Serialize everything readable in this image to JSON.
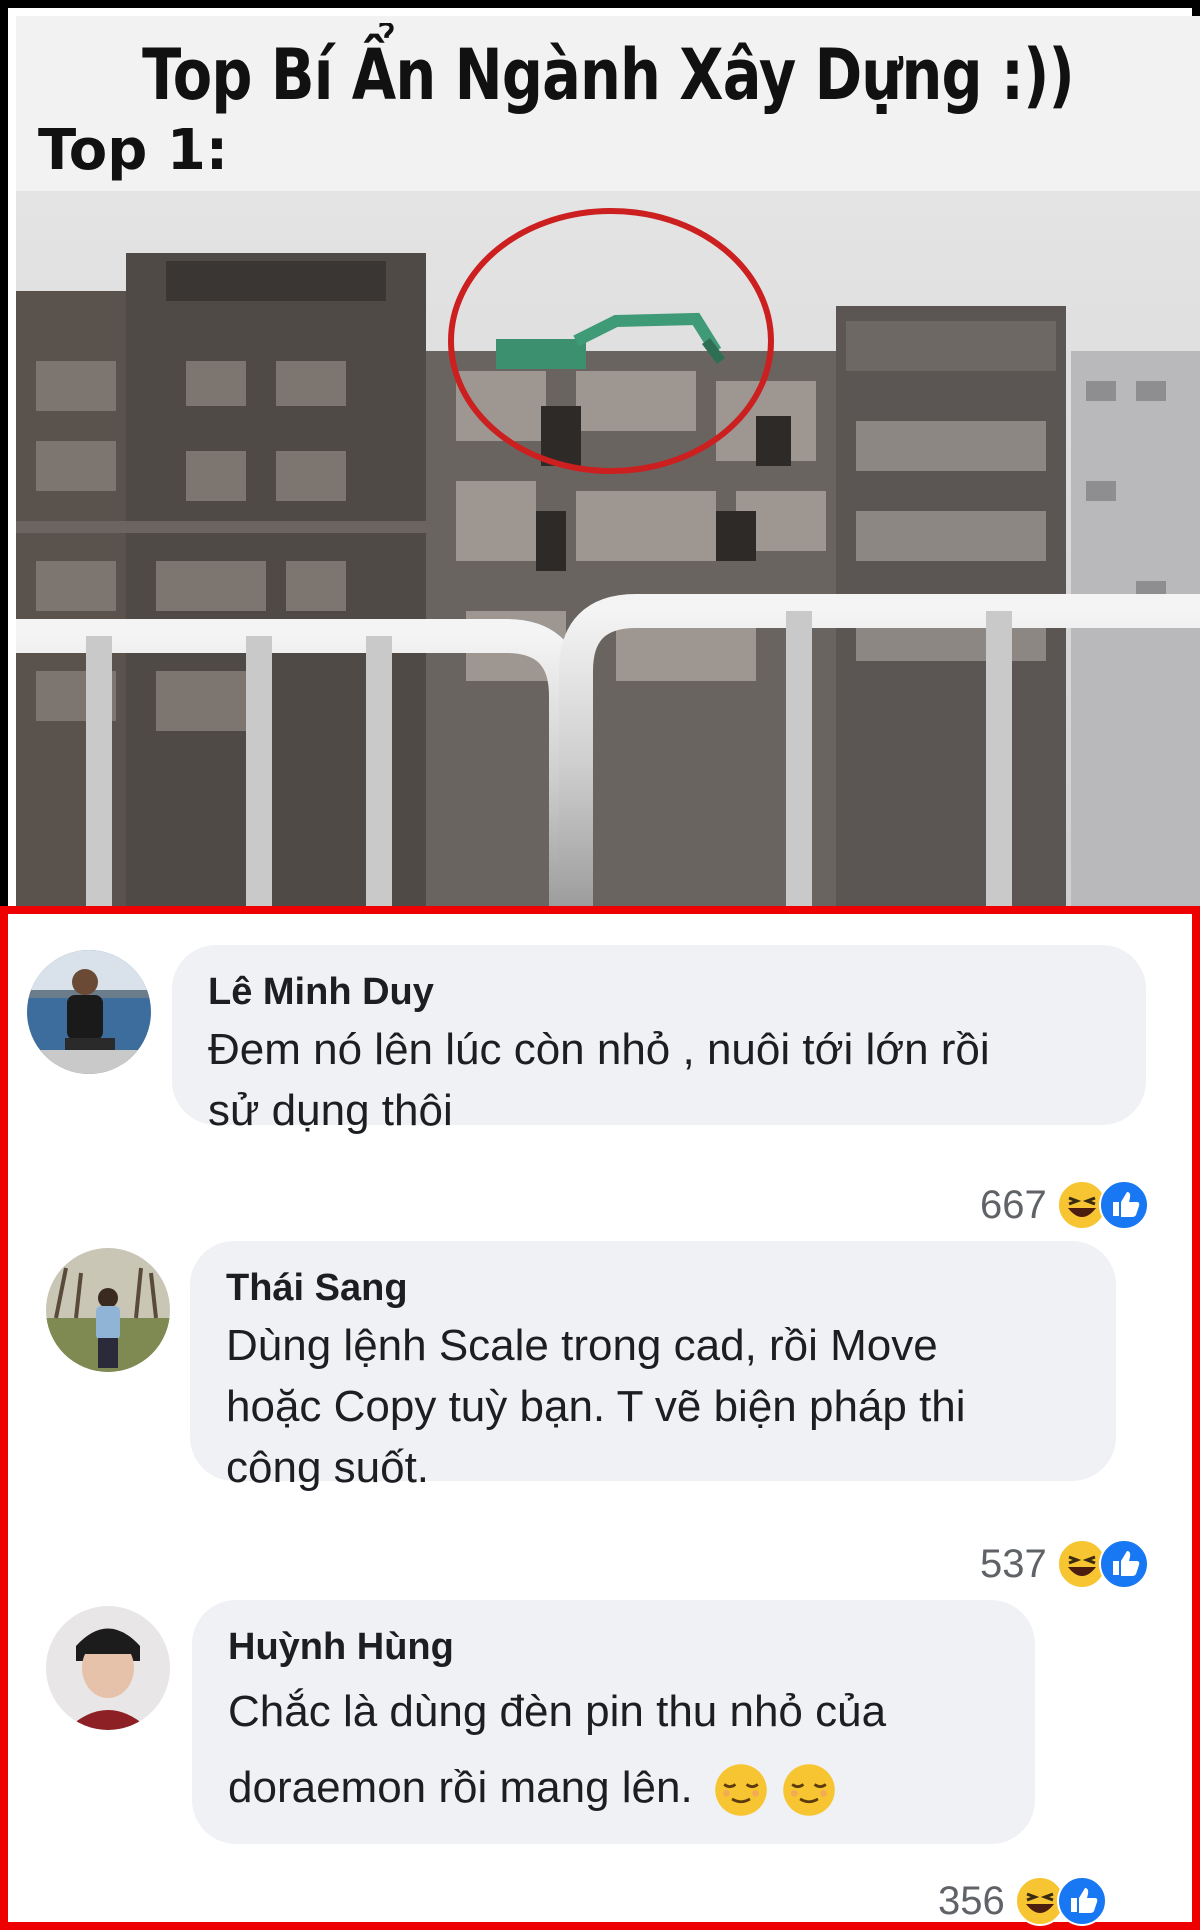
{
  "header": {
    "title": "Top Bí Ẩn Ngành Xây Dựng :))",
    "subtitle": "Top 1:"
  },
  "comments": [
    {
      "author": "Lê Minh Duy",
      "text_line1": "Đem nó lên lúc còn nhỏ , nuôi tới lớn rồi",
      "text_line2": "sử dụng thôi",
      "reaction_count": "667",
      "reactions": [
        "haha-icon",
        "like-icon"
      ]
    },
    {
      "author": "Thái Sang",
      "text_line1": "Dùng lệnh Scale trong cad, rồi Move",
      "text_line2": "hoặc Copy tuỳ bạn. T vẽ biện pháp thi",
      "text_line3": "công suốt.",
      "reaction_count": "537",
      "reactions": [
        "haha-icon",
        "like-icon"
      ]
    },
    {
      "author": "Huỳnh Hùng",
      "text_line1": "Chắc là dùng đèn pin thu nhỏ của",
      "text_line2": "doraemon rồi mang lên.",
      "reaction_count": "356",
      "reactions": [
        "haha-icon",
        "like-icon"
      ]
    }
  ],
  "colors": {
    "highlight_border": "#ee0000",
    "bubble_bg": "#eff1f4",
    "like_blue": "#1877f2",
    "haha_yellow": "#f7c531"
  }
}
